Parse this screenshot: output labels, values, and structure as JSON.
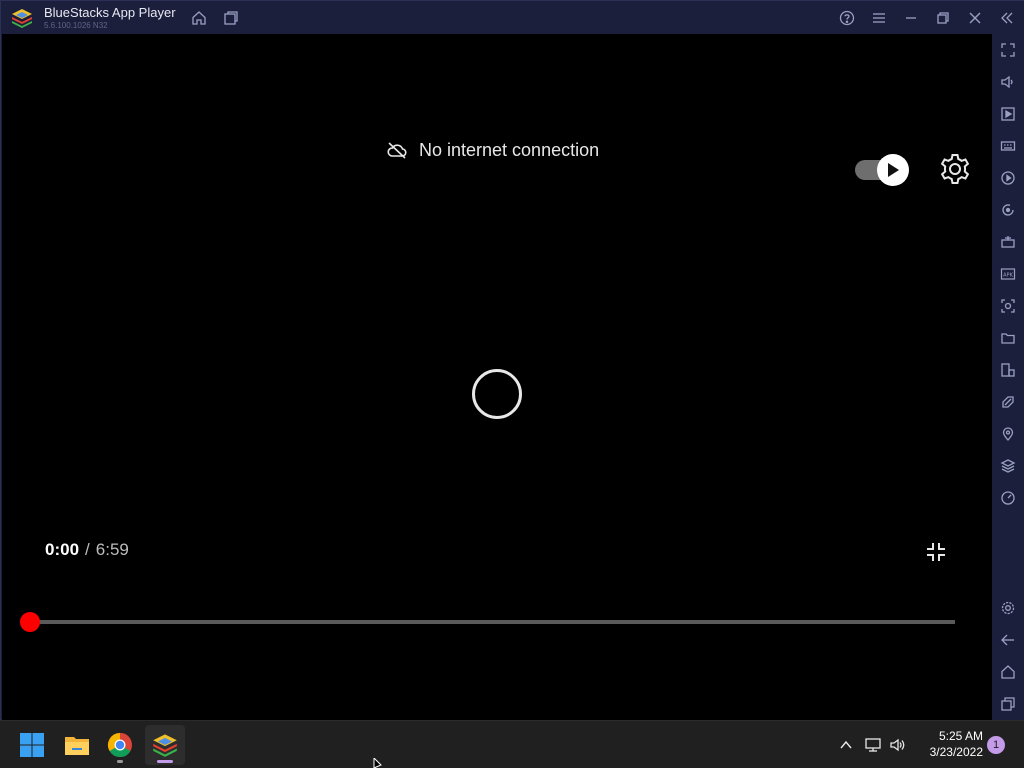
{
  "window": {
    "title": "BlueStacks App Player",
    "version": "5.6.100.1026 N32"
  },
  "player": {
    "no_internet_text": "No internet connection",
    "current_time": "0:00",
    "separator": "/",
    "duration": "6:59",
    "progress_fraction": 0.0,
    "autoplay_on": true,
    "accent_color": "#ff0000"
  },
  "titlebar_icons": [
    "home-icon",
    "multi-instance-icon",
    "help-icon",
    "menu-icon",
    "minimize-icon",
    "restore-icon",
    "close-icon",
    "collapse-sidebar-icon"
  ],
  "sidebar_icons": [
    "fullscreen-icon",
    "volume-icon",
    "media-icon",
    "keyboard-icon",
    "macro-icon",
    "rotate-icon",
    "gamepad-icon",
    "apk-icon",
    "screenshot-icon",
    "folder-icon",
    "multi-device-icon",
    "eco-mode-icon",
    "location-icon",
    "layers-icon",
    "performance-icon",
    "settings-icon",
    "back-icon",
    "home-icon",
    "recents-icon"
  ],
  "taskbar": {
    "apps": [
      "windows-start-icon",
      "file-explorer-icon",
      "chrome-icon",
      "bluestacks-icon"
    ],
    "time": "5:25 AM",
    "date": "3/23/2022",
    "notification_count": "1"
  }
}
